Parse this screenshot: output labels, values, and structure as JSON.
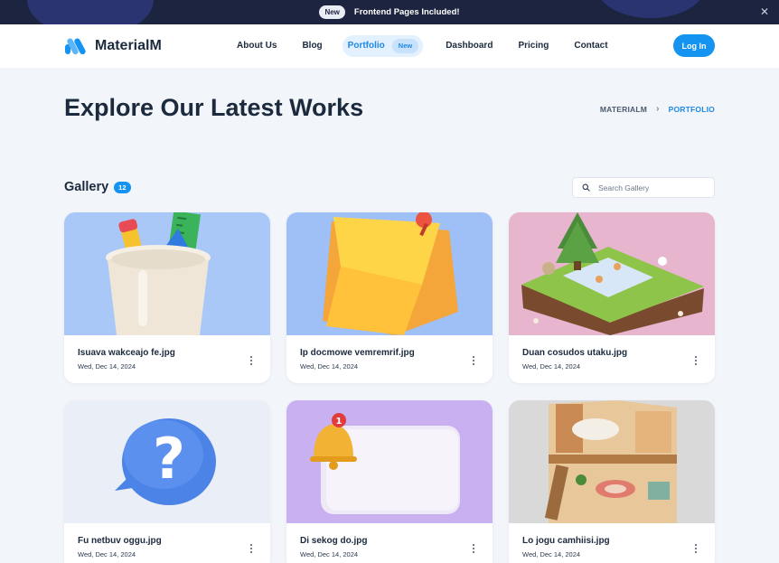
{
  "announcement": {
    "badge": "New",
    "message": "Frontend Pages Included!"
  },
  "header": {
    "brand": "MaterialM",
    "nav": [
      {
        "label": "About Us"
      },
      {
        "label": "Blog"
      },
      {
        "label": "Portfolio",
        "badge": "New",
        "active": true
      },
      {
        "label": "Dashboard"
      },
      {
        "label": "Pricing"
      },
      {
        "label": "Contact"
      }
    ],
    "login_label": "Log In"
  },
  "page": {
    "title": "Explore Our Latest Works",
    "breadcrumb": [
      "MATERIALM",
      "PORTFOLIO"
    ]
  },
  "gallery": {
    "title": "Gallery",
    "count": "12",
    "search_placeholder": "Search Gallery",
    "items": [
      {
        "name": "Isuava wakceajo fe.jpg",
        "date": "Wed, Dec 14, 2024"
      },
      {
        "name": "Ip docmowe vemremrif.jpg",
        "date": "Wed, Dec 14, 2024"
      },
      {
        "name": "Duan cosudos utaku.jpg",
        "date": "Wed, Dec 14, 2024"
      },
      {
        "name": "Fu netbuv oggu.jpg",
        "date": "Wed, Dec 14, 2024"
      },
      {
        "name": "Di sekog do.jpg",
        "date": "Wed, Dec 14, 2024"
      },
      {
        "name": "Lo jogu camhiisi.jpg",
        "date": "Wed, Dec 14, 2024"
      }
    ]
  },
  "colors": {
    "accent": "#1493f0",
    "dark": "#1d2440",
    "text": "#1b2a3d",
    "background": "#f2f5fa"
  }
}
